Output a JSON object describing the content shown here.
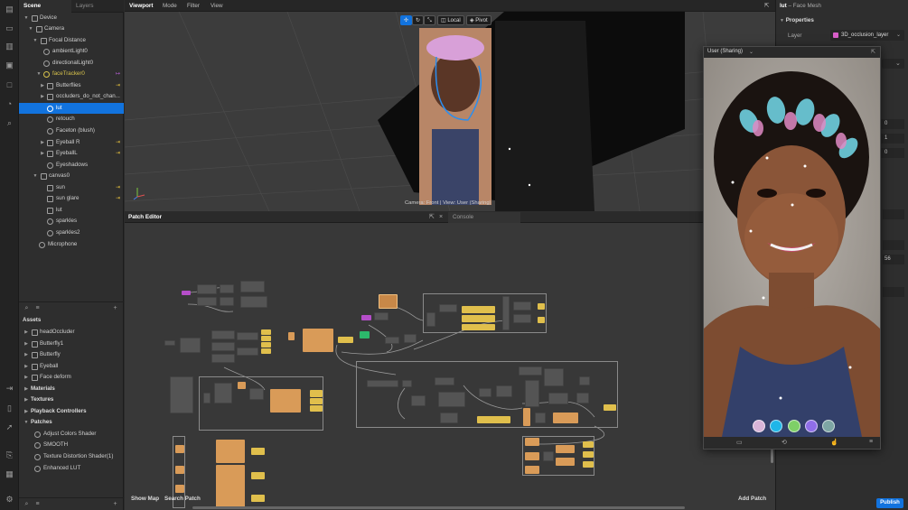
{
  "scene_tabs": {
    "scene": "Scene",
    "layers": "Layers"
  },
  "scene_tree": [
    {
      "label": "Device"
    },
    {
      "label": "Camera"
    },
    {
      "label": "Focal Distance"
    },
    {
      "label": "ambientLight0"
    },
    {
      "label": "directionalLight0"
    },
    {
      "label": "faceTracker0"
    },
    {
      "label": "Butterflies"
    },
    {
      "label": "occluders_do_not_chan..."
    },
    {
      "label": "lut"
    },
    {
      "label": "retouch"
    },
    {
      "label": "Faceton (blush)"
    },
    {
      "label": "Eyeball R"
    },
    {
      "label": "EyeballL"
    },
    {
      "label": "Eyeshadows"
    },
    {
      "label": "canvas0"
    },
    {
      "label": "sun"
    },
    {
      "label": "sun glare"
    },
    {
      "label": "lut"
    },
    {
      "label": "sparkles"
    },
    {
      "label": "sparkles2"
    },
    {
      "label": "Microphone"
    }
  ],
  "assets": {
    "title": "Assets",
    "items": [
      {
        "label": "headOccluder"
      },
      {
        "label": "Butterfly1"
      },
      {
        "label": "Butterfly"
      },
      {
        "label": "Eyeball"
      },
      {
        "label": "Face deform"
      }
    ],
    "sections": [
      {
        "label": "Materials"
      },
      {
        "label": "Textures"
      },
      {
        "label": "Playback Controllers"
      },
      {
        "label": "Patches"
      }
    ],
    "patches": [
      {
        "label": "Adjust Colors Shader"
      },
      {
        "label": "SMOOTH"
      },
      {
        "label": "Texture Distortion Shader(1)"
      },
      {
        "label": "Enhanced LUT"
      }
    ]
  },
  "viewport": {
    "tabs": [
      "Viewport",
      "Mode",
      "Filter",
      "View"
    ],
    "local_label": "Local",
    "pivot_label": "Pivot",
    "camera_status": "Camera: Front | View: User (Sharing)"
  },
  "patch_editor": {
    "title": "Patch Editor",
    "console_tab": "Console",
    "show_map": "Show Map",
    "search_patch": "Search Patch",
    "add_patch": "Add Patch"
  },
  "properties": {
    "object_name": "lut",
    "object_type": "– Face Mesh",
    "section": "Properties",
    "layer_label": "Layer",
    "layer_value": "3D_occlusion_layer",
    "values": [
      "0",
      "1",
      "0"
    ],
    "partial_value": "56"
  },
  "preview": {
    "title": "User (Sharing)",
    "swatch_colors": [
      "#d8b4d8",
      "#1fb6e8",
      "#7ed067",
      "#8f6ee8",
      "#7ea6a4"
    ]
  },
  "publish_label": "Publish"
}
